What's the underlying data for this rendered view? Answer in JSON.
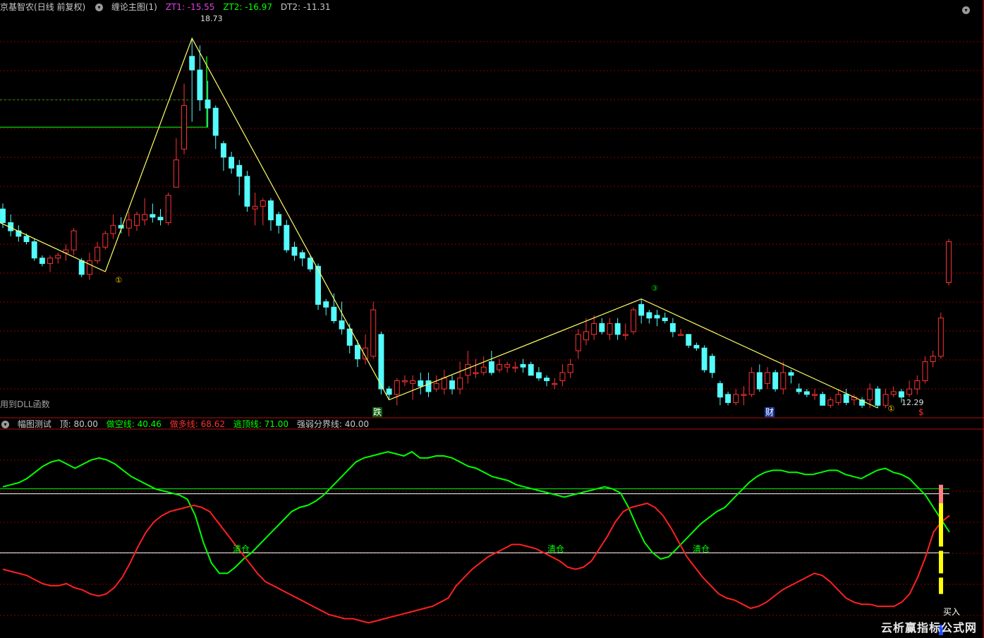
{
  "header_main": {
    "stock": "京基智农",
    "mode": "(日线 前复权)",
    "indicator": "缠论主图(1)",
    "zt1_label": "ZT1: -15.55",
    "zt2_label": "ZT2: -16.97",
    "dt2_label": "DT2: -11.31"
  },
  "header_sub": {
    "name": "幅图测试",
    "top": "顶: 80.00",
    "short_line": "做空线: 40.46",
    "long_line": "做多线: 68.62",
    "escape_line": "逃顶线: 71.00",
    "strength_line": "强弱分界线: 40.00"
  },
  "note_dll": "用到DLL函数",
  "watermark": "云析赢指标公式网",
  "colors": {
    "bg": "#000000",
    "up": "#ff3232",
    "down": "#54fcfc",
    "grid": "#8b0000",
    "zigzag": "#ffff66",
    "green": "#00ff00",
    "red": "#ff2020",
    "white": "#ffffff",
    "yellow": "#ffff00",
    "blue": "#2050ff"
  },
  "chart_data": [
    {
      "type": "candlestick",
      "title": "缠论主图(1)",
      "ylim": [
        11.9,
        19.2
      ],
      "annotations": {
        "high_label": "18.73",
        "low_label": "12.29",
        "markers": [
          "①",
          "③",
          "①"
        ],
        "signals": [
          "跌",
          "财",
          "$"
        ]
      },
      "support_lines": [
        17.6,
        17.1
      ],
      "candles": [
        [
          15.6,
          15.35,
          15.7,
          15.25
        ],
        [
          15.35,
          15.2,
          15.5,
          15.1
        ],
        [
          15.2,
          15.1,
          15.3,
          15.0
        ],
        [
          15.1,
          15.0,
          15.15,
          14.95
        ],
        [
          15.0,
          14.7,
          15.05,
          14.65
        ],
        [
          14.7,
          14.6,
          14.75,
          14.55
        ],
        [
          14.6,
          14.7,
          14.75,
          14.45
        ],
        [
          14.7,
          14.75,
          14.8,
          14.6
        ],
        [
          14.8,
          14.85,
          14.95,
          14.65
        ],
        [
          14.85,
          15.2,
          15.25,
          14.75
        ],
        [
          14.65,
          14.4,
          14.7,
          14.35
        ],
        [
          14.4,
          14.65,
          14.8,
          14.3
        ],
        [
          14.65,
          14.9,
          15.0,
          14.6
        ],
        [
          14.9,
          15.15,
          15.2,
          14.85
        ],
        [
          15.15,
          15.3,
          15.5,
          15.05
        ],
        [
          15.3,
          15.25,
          15.45,
          15.15
        ],
        [
          15.25,
          15.4,
          15.55,
          15.1
        ],
        [
          15.3,
          15.5,
          15.55,
          15.2
        ],
        [
          15.4,
          15.5,
          15.8,
          15.3
        ],
        [
          15.5,
          15.45,
          15.7,
          15.35
        ],
        [
          15.45,
          15.4,
          15.6,
          15.3
        ],
        [
          15.35,
          15.85,
          15.9,
          15.3
        ],
        [
          16.0,
          16.5,
          16.9,
          16.0
        ],
        [
          16.7,
          17.5,
          17.9,
          16.6
        ],
        [
          18.4,
          18.15,
          18.73,
          17.2
        ],
        [
          18.15,
          17.6,
          18.6,
          17.4
        ],
        [
          17.6,
          17.45,
          17.95,
          17.1
        ],
        [
          17.45,
          16.95,
          17.5,
          16.7
        ],
        [
          16.8,
          16.55,
          16.85,
          16.3
        ],
        [
          16.55,
          16.35,
          16.65,
          16.25
        ],
        [
          16.4,
          16.2,
          16.5,
          15.85
        ],
        [
          16.2,
          15.65,
          16.3,
          15.55
        ],
        [
          15.6,
          15.65,
          15.9,
          15.3
        ],
        [
          15.65,
          15.75,
          15.8,
          15.3
        ],
        [
          15.75,
          15.4,
          15.8,
          15.2
        ],
        [
          15.5,
          15.3,
          15.55,
          15.15
        ],
        [
          15.3,
          14.85,
          15.4,
          14.8
        ],
        [
          14.9,
          14.75,
          15.0,
          14.65
        ],
        [
          14.8,
          14.7,
          14.85,
          14.55
        ],
        [
          14.7,
          14.5,
          14.75,
          14.45
        ],
        [
          14.55,
          13.85,
          14.6,
          13.75
        ],
        [
          13.9,
          13.8,
          13.95,
          13.65
        ],
        [
          13.8,
          13.55,
          14.05,
          13.5
        ],
        [
          13.55,
          13.4,
          13.9,
          13.3
        ],
        [
          13.4,
          13.1,
          13.5,
          12.95
        ],
        [
          13.1,
          12.85,
          13.2,
          12.7
        ],
        [
          12.85,
          13.05,
          13.3,
          12.75
        ],
        [
          12.9,
          13.75,
          13.9,
          12.85
        ],
        [
          13.3,
          12.3,
          13.35,
          12.2
        ],
        [
          12.3,
          12.2,
          12.35,
          12.1
        ],
        [
          12.2,
          12.45,
          12.5,
          12.0
        ],
        [
          12.45,
          12.45,
          12.55,
          12.35
        ],
        [
          12.4,
          12.45,
          12.55,
          12.1
        ],
        [
          12.45,
          12.35,
          12.6,
          12.2
        ],
        [
          12.45,
          12.25,
          12.6,
          12.15
        ],
        [
          12.3,
          12.4,
          12.55,
          12.25
        ],
        [
          12.3,
          12.5,
          12.65,
          12.2
        ],
        [
          12.45,
          12.3,
          12.55,
          12.2
        ],
        [
          12.3,
          12.5,
          12.8,
          12.2
        ],
        [
          12.55,
          12.75,
          13.0,
          12.4
        ],
        [
          12.6,
          12.6,
          12.85,
          12.5
        ],
        [
          12.6,
          12.7,
          12.9,
          12.55
        ],
        [
          12.8,
          12.6,
          13.0,
          12.55
        ],
        [
          12.65,
          12.75,
          12.85,
          12.6
        ],
        [
          12.7,
          12.75,
          12.8,
          12.6
        ],
        [
          12.7,
          12.7,
          12.8,
          12.6
        ],
        [
          12.75,
          12.7,
          12.85,
          12.6
        ],
        [
          12.75,
          12.55,
          12.8,
          12.55
        ],
        [
          12.6,
          12.5,
          12.7,
          12.45
        ],
        [
          12.5,
          12.45,
          12.55,
          12.35
        ],
        [
          12.4,
          12.4,
          12.5,
          12.3
        ],
        [
          12.45,
          12.6,
          12.75,
          12.35
        ],
        [
          12.6,
          12.75,
          12.85,
          12.5
        ],
        [
          13.0,
          13.3,
          13.4,
          12.85
        ],
        [
          13.2,
          13.35,
          13.6,
          13.1
        ],
        [
          13.3,
          13.5,
          13.65,
          13.2
        ],
        [
          13.5,
          13.35,
          13.6,
          13.3
        ],
        [
          13.3,
          13.5,
          13.6,
          13.2
        ],
        [
          13.5,
          13.3,
          13.6,
          13.2
        ],
        [
          13.3,
          13.3,
          13.5,
          13.2
        ],
        [
          13.35,
          13.75,
          13.8,
          13.3
        ],
        [
          13.85,
          13.65,
          13.95,
          13.5
        ],
        [
          13.7,
          13.6,
          13.75,
          13.5
        ],
        [
          13.65,
          13.6,
          13.75,
          13.45
        ],
        [
          13.6,
          13.55,
          13.7,
          13.5
        ],
        [
          13.5,
          13.35,
          13.6,
          13.25
        ],
        [
          13.3,
          13.3,
          13.4,
          13.3
        ],
        [
          13.3,
          13.1,
          13.3,
          13.05
        ],
        [
          13.1,
          13.05,
          13.15,
          13.0
        ],
        [
          13.05,
          12.65,
          13.1,
          12.6
        ],
        [
          12.9,
          12.6,
          12.95,
          12.5
        ],
        [
          12.4,
          12.15,
          12.45,
          12.0
        ],
        [
          12.2,
          12.05,
          12.25,
          12.0
        ],
        [
          12.05,
          12.2,
          12.3,
          12.0
        ],
        [
          12.2,
          12.2,
          12.35,
          12.0
        ],
        [
          12.2,
          12.6,
          12.7,
          12.15
        ],
        [
          12.6,
          12.3,
          12.75,
          12.25
        ],
        [
          12.4,
          12.6,
          12.7,
          12.3
        ],
        [
          12.6,
          12.3,
          12.65,
          12.25
        ],
        [
          12.3,
          12.6,
          12.8,
          12.2
        ],
        [
          12.6,
          12.55,
          12.65,
          12.4
        ],
        [
          12.3,
          12.25,
          12.4,
          12.2
        ],
        [
          12.25,
          12.2,
          12.3,
          12.15
        ],
        [
          12.2,
          12.2,
          12.3,
          12.1
        ],
        [
          12.2,
          12.0,
          12.25,
          12.0
        ],
        [
          12.0,
          12.1,
          12.15,
          11.95
        ],
        [
          12.05,
          12.2,
          12.3,
          12.0
        ],
        [
          12.2,
          12.05,
          12.3,
          12.0
        ],
        [
          12.1,
          12.15,
          12.2,
          12.0
        ],
        [
          12.1,
          12.0,
          12.15,
          11.95
        ],
        [
          12.1,
          12.3,
          12.4,
          11.95
        ],
        [
          12.3,
          12.0,
          12.35,
          11.95
        ],
        [
          12.0,
          12.2,
          12.3,
          11.95
        ],
        [
          12.2,
          12.25,
          12.35,
          12.15
        ],
        [
          12.25,
          12.15,
          12.3,
          12.05
        ],
        [
          12.2,
          12.3,
          12.45,
          12.15
        ],
        [
          12.3,
          12.45,
          12.55,
          12.2
        ],
        [
          12.45,
          12.8,
          12.9,
          12.4
        ],
        [
          12.8,
          12.9,
          13.0,
          12.7
        ],
        [
          12.9,
          13.6,
          13.7,
          12.85
        ],
        [
          14.25,
          15.0,
          15.05,
          14.2
        ]
      ]
    },
    {
      "type": "line",
      "title": "幅图测试",
      "ylim": [
        0,
        100
      ],
      "hlines": [
        {
          "name": "做多线",
          "value": 68.62,
          "color": "#ffffff"
        },
        {
          "name": "逃顶线",
          "value": 71.0,
          "color": "#00ff00"
        },
        {
          "name": "强弱分界线",
          "value": 40.0,
          "color": "#ffffff"
        }
      ],
      "labels": [
        "清仓",
        "清仓",
        "清仓",
        "买入"
      ],
      "series": [
        {
          "name": "做多线",
          "color": "#00ff00",
          "values": [
            72,
            73,
            74,
            76,
            79,
            82,
            84,
            85,
            83,
            81,
            83,
            85,
            86,
            85,
            83,
            80,
            77,
            75,
            73,
            71,
            70,
            69,
            68,
            66,
            58,
            45,
            35,
            30,
            30,
            33,
            37,
            40,
            44,
            48,
            52,
            56,
            60,
            62,
            63,
            65,
            68,
            72,
            76,
            80,
            84,
            86,
            87,
            88,
            89,
            88,
            87,
            89,
            86,
            86,
            87,
            87,
            86,
            84,
            82,
            81,
            79,
            77,
            76,
            75,
            73,
            72,
            71,
            70,
            69,
            68,
            67,
            68,
            69,
            70,
            71,
            72,
            71,
            69,
            62,
            53,
            45,
            40,
            37,
            38,
            42,
            46,
            50,
            54,
            57,
            60,
            62,
            66,
            70,
            74,
            77,
            79,
            80,
            80,
            79,
            79,
            78,
            78,
            79,
            80,
            80,
            78,
            77,
            76,
            78,
            80,
            81,
            79,
            78,
            76,
            72,
            68,
            62,
            56,
            50
          ]
        },
        {
          "name": "做空线",
          "color": "#ff2020",
          "values": [
            32,
            31,
            30,
            29,
            27,
            25,
            24,
            24,
            25,
            23,
            22,
            20,
            19,
            20,
            23,
            28,
            35,
            43,
            50,
            55,
            58,
            60,
            61,
            62,
            63,
            62,
            60,
            55,
            50,
            45,
            40,
            35,
            30,
            26,
            24,
            22,
            20,
            18,
            16,
            14,
            12,
            10,
            9,
            8,
            8,
            7,
            6,
            7,
            8,
            9,
            10,
            11,
            12,
            13,
            14,
            16,
            18,
            24,
            28,
            32,
            35,
            38,
            40,
            42,
            44,
            44,
            43,
            42,
            40,
            38,
            36,
            33,
            32,
            33,
            36,
            42,
            48,
            55,
            60,
            62,
            63,
            64,
            62,
            58,
            52,
            45,
            38,
            33,
            28,
            24,
            20,
            18,
            17,
            15,
            13,
            14,
            16,
            19,
            22,
            24,
            26,
            28,
            30,
            29,
            26,
            22,
            18,
            16,
            15,
            15,
            14,
            14,
            14,
            16,
            20,
            28,
            38,
            50,
            55,
            58
          ]
        }
      ]
    }
  ]
}
